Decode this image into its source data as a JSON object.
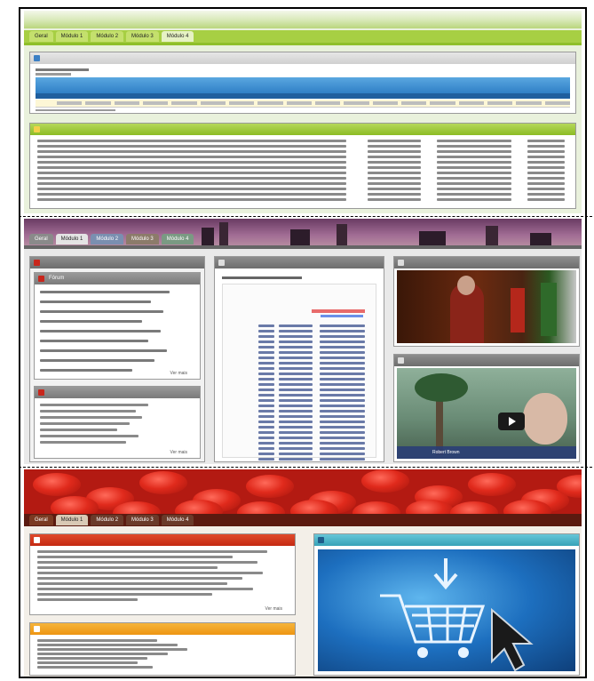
{
  "panel1": {
    "tabs": [
      "Geral",
      "Módulo 1",
      "Módulo 2",
      "Módulo 3",
      "Módulo 4"
    ],
    "grid_box_title": "",
    "grid_box_subtitle": "",
    "links_box_title": ""
  },
  "panel2": {
    "tabs": [
      "Geral",
      "Módulo 1",
      "Módulo 2",
      "Módulo 3",
      "Módulo 4"
    ],
    "left_box_title": "",
    "forum_box_title": "Fórum",
    "forum_more": "Ver mais",
    "second_box_title": "",
    "second_more": "Ver mais",
    "center_box_title": "",
    "center_doc_title": "",
    "video_box_title": "",
    "video2_box_title": "",
    "player_label": "Robert Brown"
  },
  "panel3": {
    "header_title": "",
    "tabs": [
      "Geral",
      "Módulo 1",
      "Módulo 2",
      "Módulo 3",
      "Módulo 4"
    ],
    "news_box_title": "",
    "news_more": "Ver mais",
    "orange_box_title": "",
    "right_box_title": ""
  },
  "colors": {
    "green_accent": "#9cc93a",
    "blue_accent": "#3a86c8",
    "red_header": "#c81f14",
    "orange_accent": "#f0a21b",
    "teal_accent": "#4fb4c9"
  }
}
